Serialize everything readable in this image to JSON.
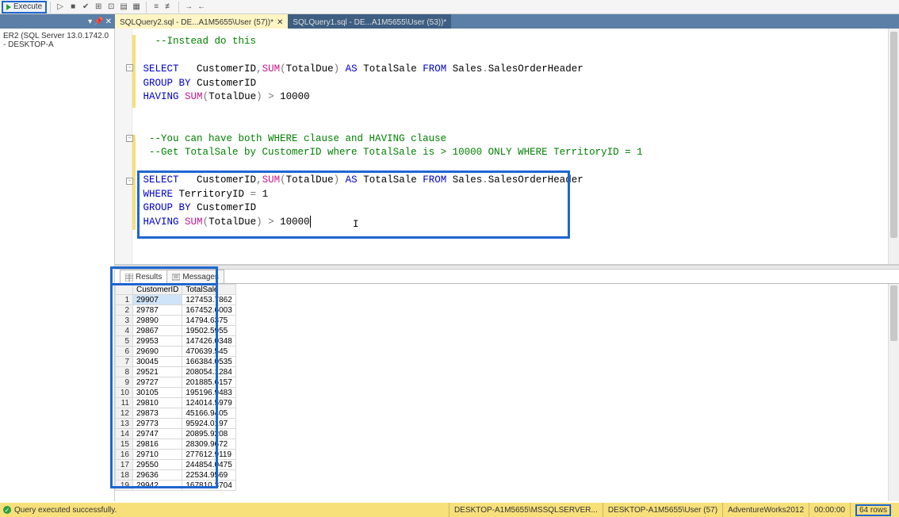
{
  "toolbar": {
    "execute": "Execute"
  },
  "objexplorer": {
    "server": "ER2 (SQL Server 13.0.1742.0 - DESKTOP-A"
  },
  "tabs": {
    "active": "SQLQuery2.sql - DE...A1M5655\\User (57))*",
    "inactive": "SQLQuery1.sql - DE...A1M5655\\User (53))*"
  },
  "code": {
    "c1": "--Instead do this",
    "l1a": "SELECT",
    "l1b": " CustomerID",
    "l1c": "SUM",
    "l1d": "TotalDue",
    "l1e": "AS",
    "l1f": "TotalSale",
    "l1g": "FROM",
    "l1h": "Sales",
    "l1i": "SalesOrderHeader",
    "l2a": "GROUP",
    "l2b": "BY",
    "l2c": "CustomerID",
    "l3a": "HAVING",
    "l3b": "SUM",
    "l3c": "TotalDue",
    "l3d": ">",
    "l3e": "10000",
    "c2": "--You can have both WHERE clause and HAVING clause",
    "c3": "--Get TotalSale by CustomerID where TotalSale is > 10000 ONLY WHERE TerritoryID = 1",
    "l4a": "WHERE",
    "l4b": "TerritoryID",
    "l4c": "=",
    "l4d": "1"
  },
  "results": {
    "tabs": {
      "results": "Results",
      "messages": "Messages"
    },
    "columns": [
      "",
      "CustomerID",
      "TotalSale"
    ],
    "rows": [
      [
        "1",
        "29907",
        "127453.7862"
      ],
      [
        "2",
        "29787",
        "167452.6003"
      ],
      [
        "3",
        "29890",
        "14794.6375"
      ],
      [
        "4",
        "29867",
        "19502.5955"
      ],
      [
        "5",
        "29953",
        "147426.0348"
      ],
      [
        "6",
        "29690",
        "470639.545"
      ],
      [
        "7",
        "30045",
        "166384.0535"
      ],
      [
        "8",
        "29521",
        "208054.1284"
      ],
      [
        "9",
        "29727",
        "201885.6157"
      ],
      [
        "10",
        "30105",
        "195196.9483"
      ],
      [
        "11",
        "29810",
        "124014.5979"
      ],
      [
        "12",
        "29873",
        "45166.9405"
      ],
      [
        "13",
        "29773",
        "95924.0197"
      ],
      [
        "14",
        "29747",
        "20895.9208"
      ],
      [
        "15",
        "29816",
        "28309.9672"
      ],
      [
        "16",
        "29710",
        "277612.9119"
      ],
      [
        "17",
        "29550",
        "244854.0475"
      ],
      [
        "18",
        "29636",
        "22534.9569"
      ],
      [
        "19",
        "29942",
        "167810.3704"
      ]
    ]
  },
  "status": {
    "msg": "Query executed successfully.",
    "server": "DESKTOP-A1M5655\\MSSQLSERVER...",
    "user": "DESKTOP-A1M5655\\User (57)",
    "db": "AdventureWorks2012",
    "time": "00:00:00",
    "rows": "64 rows"
  }
}
